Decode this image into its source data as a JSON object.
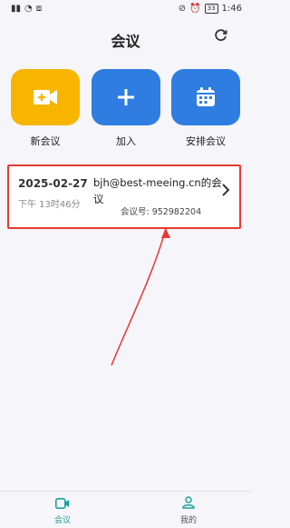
{
  "status_bar": {
    "time": "1:46",
    "battery": "33"
  },
  "header": {
    "title": "会议"
  },
  "actions": [
    {
      "label": "新会议",
      "icon": "video-camera-icon",
      "color": "#f7b500"
    },
    {
      "label": "加入",
      "icon": "plus-icon",
      "color": "#2f7de1"
    },
    {
      "label": "安排会议",
      "icon": "calendar-icon",
      "color": "#2f7de1"
    }
  ],
  "meeting": {
    "date": "2025-02-27",
    "time": "下午 13时46分",
    "title": "bjh@best-meeing.cn的会议",
    "id_text": "会议号: 952982204"
  },
  "bottom_nav": {
    "items": [
      {
        "label": "会议",
        "icon": "video-camera-icon",
        "active": true
      },
      {
        "label": "我的",
        "icon": "person-icon",
        "active": false
      }
    ],
    "active_color": "#1aa39a"
  }
}
